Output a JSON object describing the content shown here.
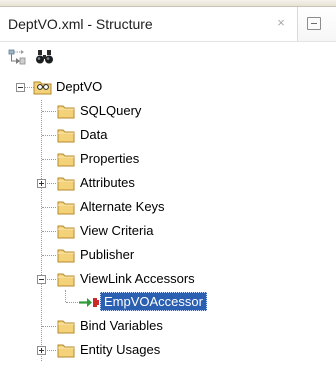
{
  "window": {
    "title": "DeptVO.xml - Structure",
    "close_glyph": "×"
  },
  "toolbar": {
    "buttons": [
      {
        "icon": "hierarchy-icon"
      },
      {
        "icon": "binoculars-icon"
      }
    ]
  },
  "tree": {
    "root": {
      "label": "DeptVO",
      "expanded": true
    },
    "children": [
      {
        "label": "SQLQuery"
      },
      {
        "label": "Data"
      },
      {
        "label": "Properties"
      },
      {
        "label": "Attributes",
        "expandable": true
      },
      {
        "label": "Alternate Keys"
      },
      {
        "label": "View Criteria"
      },
      {
        "label": "Publisher"
      },
      {
        "label": "ViewLink Accessors",
        "expanded": true,
        "children": [
          {
            "label": "EmpVOAccessor",
            "selected": true
          }
        ]
      },
      {
        "label": "Bind Variables"
      },
      {
        "label": "Entity Usages",
        "expandable": true
      }
    ]
  },
  "colors": {
    "folder": "#f3d27a",
    "selection": "#2b5fb1",
    "accessor_arrow": "#2e9a3a"
  }
}
